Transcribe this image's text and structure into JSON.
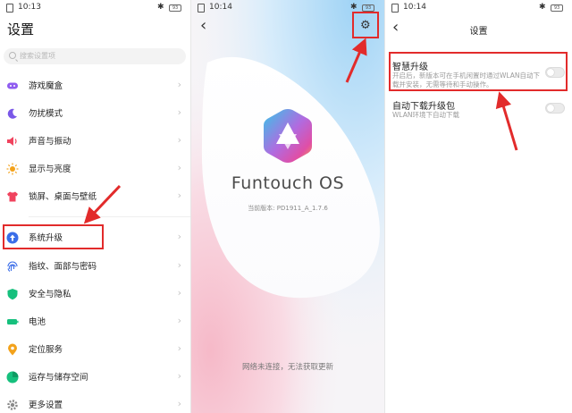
{
  "statusbar_p1": {
    "time": "10:13",
    "battery": "93"
  },
  "statusbar_p2": {
    "time": "10:14",
    "battery": "93"
  },
  "statusbar_p3": {
    "time": "10:14",
    "battery": "93"
  },
  "settings": {
    "title": "设置",
    "search_placeholder": "搜索设置项",
    "items": [
      {
        "label": "游戏魔盒",
        "icon": "gamepad-icon",
        "color": "#8f5cf0"
      },
      {
        "label": "勿扰模式",
        "icon": "moon-icon",
        "color": "#7a58e8"
      },
      {
        "label": "声音与振动",
        "icon": "speaker-icon",
        "color": "#f0435e"
      },
      {
        "label": "显示与亮度",
        "icon": "sun-icon",
        "color": "#f3a21b"
      },
      {
        "label": "锁屏、桌面与壁纸",
        "icon": "shirt-icon",
        "color": "#f0435e"
      },
      {
        "label": "系统升级",
        "icon": "upgrade-icon",
        "color": "#3a6de8"
      },
      {
        "label": "指纹、面部与密码",
        "icon": "fingerprint-icon",
        "color": "#3a6de8"
      },
      {
        "label": "安全与隐私",
        "icon": "shield-icon",
        "color": "#16c07d"
      },
      {
        "label": "电池",
        "icon": "battery-icon",
        "color": "#16c07d"
      },
      {
        "label": "定位服务",
        "icon": "location-pin-icon",
        "color": "#f3a21b"
      },
      {
        "label": "运存与储存空间",
        "icon": "storage-icon",
        "color": "#16c07d"
      },
      {
        "label": "更多设置",
        "icon": "gear-icon",
        "color": "#8a8a8a"
      }
    ]
  },
  "upgrade": {
    "os_name": "Funtouch OS",
    "version": "当前版本: PD1911_A_1.7.6",
    "status": "网络未连接，无法获取更新"
  },
  "upgrade_settings": {
    "title": "设置",
    "options": [
      {
        "title": "智慧升级",
        "desc": "开启后，新版本可在手机闲置时通过WLAN自动下载并安装，无需等待和手动操作。",
        "on": false
      },
      {
        "title": "自动下载升级包",
        "desc": "WLAN环境下自动下载",
        "on": false
      }
    ]
  },
  "colors": {
    "accent_red": "#e22b2b",
    "logo_cyan": "#36c6e8",
    "logo_magenta": "#e04ea6",
    "logo_orange": "#f4a04a"
  }
}
